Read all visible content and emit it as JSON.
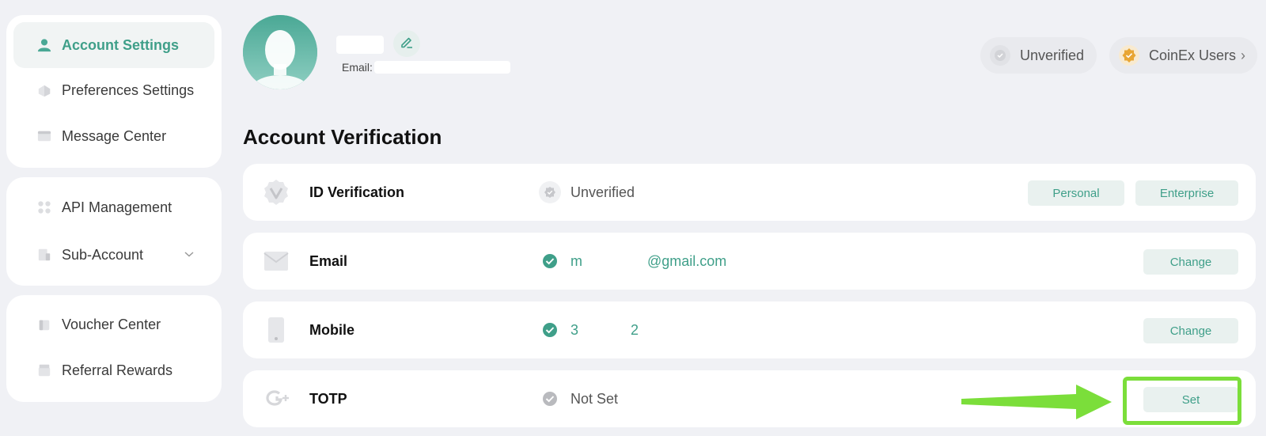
{
  "sidebar": {
    "items": [
      {
        "label": "Account Settings",
        "icon": "user-icon",
        "active": true
      },
      {
        "label": "Preferences Settings",
        "icon": "preferences-icon"
      },
      {
        "label": "Message Center",
        "icon": "message-icon"
      },
      {
        "label": "API Management",
        "icon": "api-icon"
      },
      {
        "label": "Sub-Account",
        "icon": "sub-account-icon"
      },
      {
        "label": "Voucher Center",
        "icon": "voucher-icon"
      },
      {
        "label": "Referral Rewards",
        "icon": "referral-icon"
      }
    ]
  },
  "profile": {
    "email_label": "Email:",
    "badges": {
      "verification": "Unverified",
      "user_tier": "CoinEx Users",
      "user_tier_chevron": "›"
    }
  },
  "main": {
    "title": "Account Verification",
    "rows": [
      {
        "title": "ID Verification",
        "status": "Unverified",
        "actions": [
          "Personal",
          "Enterprise"
        ]
      },
      {
        "title": "Email",
        "status_prefix": "m",
        "status_suffix": "@gmail.com",
        "action": "Change"
      },
      {
        "title": "Mobile",
        "status_prefix": "3",
        "status_suffix": "2",
        "action": "Change"
      },
      {
        "title": "TOTP",
        "status": "Not Set",
        "action": "Set"
      }
    ]
  },
  "colors": {
    "accent": "#3f9f89",
    "page_bg": "#f0f1f5",
    "highlight": "#7bde3a",
    "gold": "#e8a634"
  }
}
